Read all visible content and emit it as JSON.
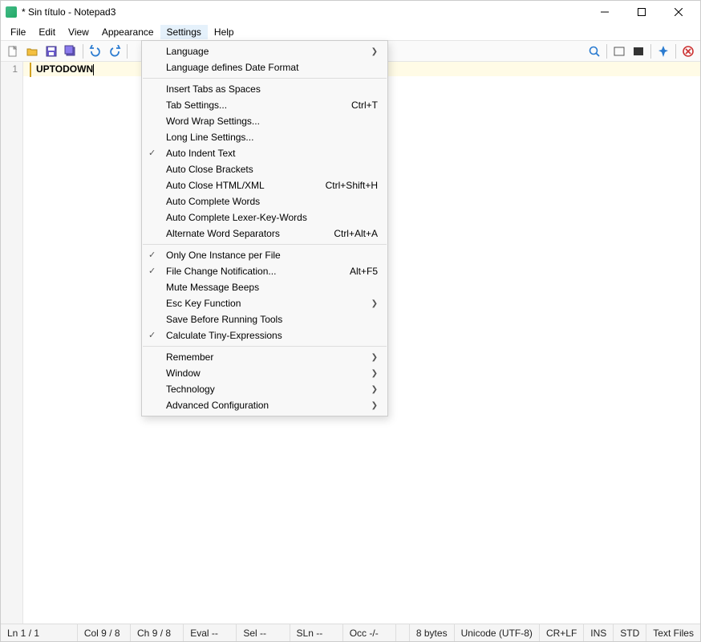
{
  "title": "* Sin título - Notepad3",
  "menubar": [
    "File",
    "Edit",
    "View",
    "Appearance",
    "Settings",
    "Help"
  ],
  "activeMenuIndex": 4,
  "editor": {
    "lineNumber": "1",
    "lineText": "UPTODOWN"
  },
  "dropdown": {
    "groups": [
      [
        {
          "label": "Language",
          "submenu": true
        },
        {
          "label": "Language defines Date Format"
        }
      ],
      [
        {
          "label": "Insert Tabs as Spaces"
        },
        {
          "label": "Tab Settings...",
          "shortcut": "Ctrl+T"
        },
        {
          "label": "Word Wrap Settings..."
        },
        {
          "label": "Long Line Settings..."
        },
        {
          "label": "Auto Indent Text",
          "checked": true
        },
        {
          "label": "Auto Close Brackets"
        },
        {
          "label": "Auto Close HTML/XML",
          "shortcut": "Ctrl+Shift+H"
        },
        {
          "label": "Auto Complete Words"
        },
        {
          "label": "Auto Complete Lexer-Key-Words"
        },
        {
          "label": "Alternate Word Separators",
          "shortcut": "Ctrl+Alt+A"
        }
      ],
      [
        {
          "label": "Only One Instance per File",
          "checked": true
        },
        {
          "label": "File Change Notification...",
          "checked": true,
          "shortcut": "Alt+F5"
        },
        {
          "label": "Mute Message Beeps"
        },
        {
          "label": "Esc Key Function",
          "submenu": true
        },
        {
          "label": "Save Before Running Tools"
        },
        {
          "label": "Calculate Tiny-Expressions",
          "checked": true
        }
      ],
      [
        {
          "label": "Remember",
          "submenu": true
        },
        {
          "label": "Window",
          "submenu": true
        },
        {
          "label": "Technology",
          "submenu": true
        },
        {
          "label": "Advanced Configuration",
          "submenu": true
        }
      ]
    ]
  },
  "status": {
    "ln": "Ln  1 / 1",
    "col": "Col  9 / 8",
    "ch": "Ch  9 / 8",
    "eval": "Eval  --",
    "sel": "Sel  --",
    "sln": "SLn  --",
    "occ": "Occ  -/-",
    "bytes": "8 bytes",
    "enc": "Unicode (UTF-8)",
    "eol": "CR+LF",
    "ins": "INS",
    "std": "STD",
    "type": "Text Files"
  }
}
